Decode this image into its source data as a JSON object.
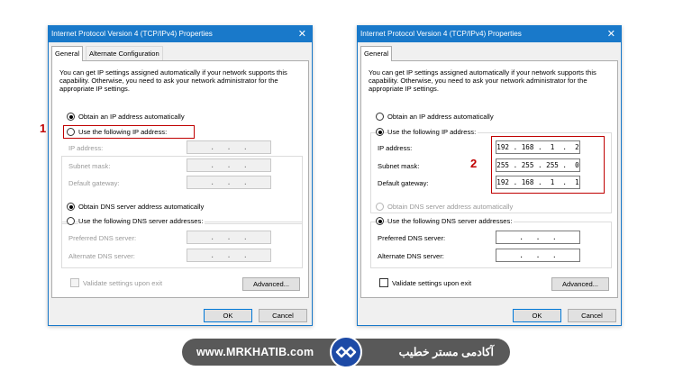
{
  "dialogs": [
    {
      "title": "Internet Protocol Version 4 (TCP/IPv4) Properties",
      "close_glyph": "✕",
      "tabs": [
        "General",
        "Alternate Configuration"
      ],
      "description": "You can get IP settings assigned automatically if your network supports this capability. Otherwise, you need to ask your network administrator for the appropriate IP settings.",
      "obtain_ip_auto": "Obtain an IP address automatically",
      "use_following_ip": "Use the following IP address:",
      "ip_label": "IP address:",
      "subnet_label": "Subnet mask:",
      "gateway_label": "Default gateway:",
      "ip_value": "   .   .   .   ",
      "subnet_value": "   .   .   .   ",
      "gateway_value": "   .   .   .   ",
      "obtain_dns_auto": "Obtain DNS server address automatically",
      "use_following_dns": "Use the following DNS server addresses:",
      "preferred_dns_label": "Preferred DNS server:",
      "alternate_dns_label": "Alternate DNS server:",
      "preferred_dns_value": "   .   .   .   ",
      "alternate_dns_value": "   .   .   .   ",
      "validate_label": "Validate settings upon exit",
      "advanced_label": "Advanced...",
      "ok_label": "OK",
      "cancel_label": "Cancel",
      "annotation": "1"
    },
    {
      "title": "Internet Protocol Version 4 (TCP/IPv4) Properties",
      "close_glyph": "✕",
      "tabs": [
        "General"
      ],
      "description": "You can get IP settings assigned automatically if your network supports this capability. Otherwise, you need to ask your network administrator for the appropriate IP settings.",
      "obtain_ip_auto": "Obtain an IP address automatically",
      "use_following_ip": "Use the following IP address:",
      "ip_label": "IP address:",
      "subnet_label": "Subnet mask:",
      "gateway_label": "Default gateway:",
      "ip_value": "192 . 168 .  1  .  2",
      "subnet_value": "255 . 255 . 255 .  0",
      "gateway_value": "192 . 168 .  1  .  1",
      "obtain_dns_auto": "Obtain DNS server address automatically",
      "use_following_dns": "Use the following DNS server addresses:",
      "preferred_dns_label": "Preferred DNS server:",
      "alternate_dns_label": "Alternate DNS server:",
      "preferred_dns_value": "   .   .   .   ",
      "alternate_dns_value": "   .   .   .   ",
      "validate_label": "Validate settings upon exit",
      "advanced_label": "Advanced...",
      "ok_label": "OK",
      "cancel_label": "Cancel",
      "annotation": "2"
    }
  ],
  "banner": {
    "url": "www.MRKHATIB.com",
    "persian": "آکادمی مستر خطیب"
  },
  "colors": {
    "titlebar": "#1979ca",
    "annotation": "#c00000",
    "banner": "#595959",
    "logo": "#1d4aa6"
  }
}
